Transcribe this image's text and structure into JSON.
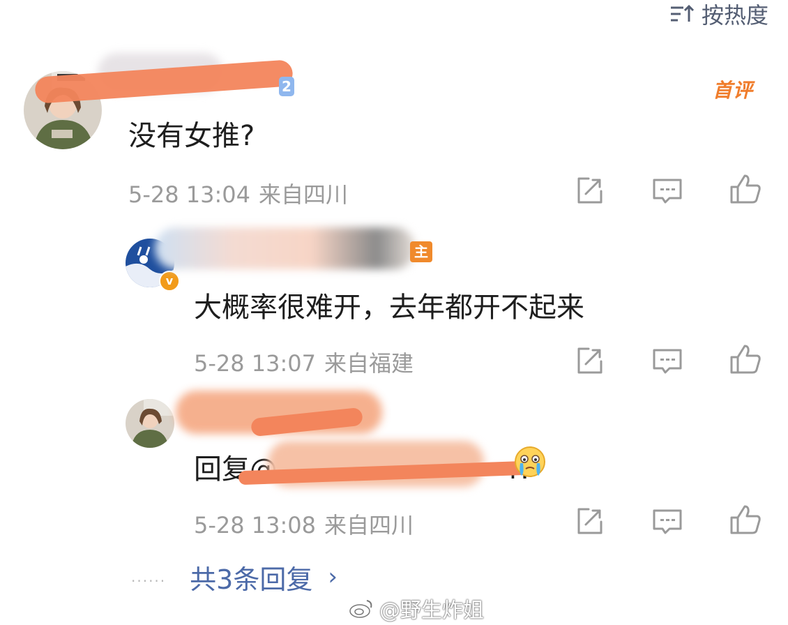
{
  "sort": {
    "label": "按热度"
  },
  "comments": [
    {
      "level_badge": "2",
      "first_badge": "首评",
      "text": "没有女推?",
      "time": "5-28 13:04",
      "location": "来自四川"
    }
  ],
  "replies": [
    {
      "owner_badge": "主",
      "text": "大概率很难开，去年都开不起来",
      "time": "5-28 13:07",
      "location": "来自福建"
    },
    {
      "text_prefix": "回复@",
      "text_suffix": "r:",
      "emoji": "crying-face",
      "time": "5-28 13:08",
      "location": "来自四川"
    }
  ],
  "more_replies": {
    "dots": "......",
    "label": "共3条回复",
    "chevron": "›"
  },
  "watermark": {
    "text": "@野生炸姐"
  },
  "colors": {
    "accent_blue": "#4c6aa8",
    "scribble_orange": "#f3855c",
    "meta_gray": "#9a9a9a"
  }
}
